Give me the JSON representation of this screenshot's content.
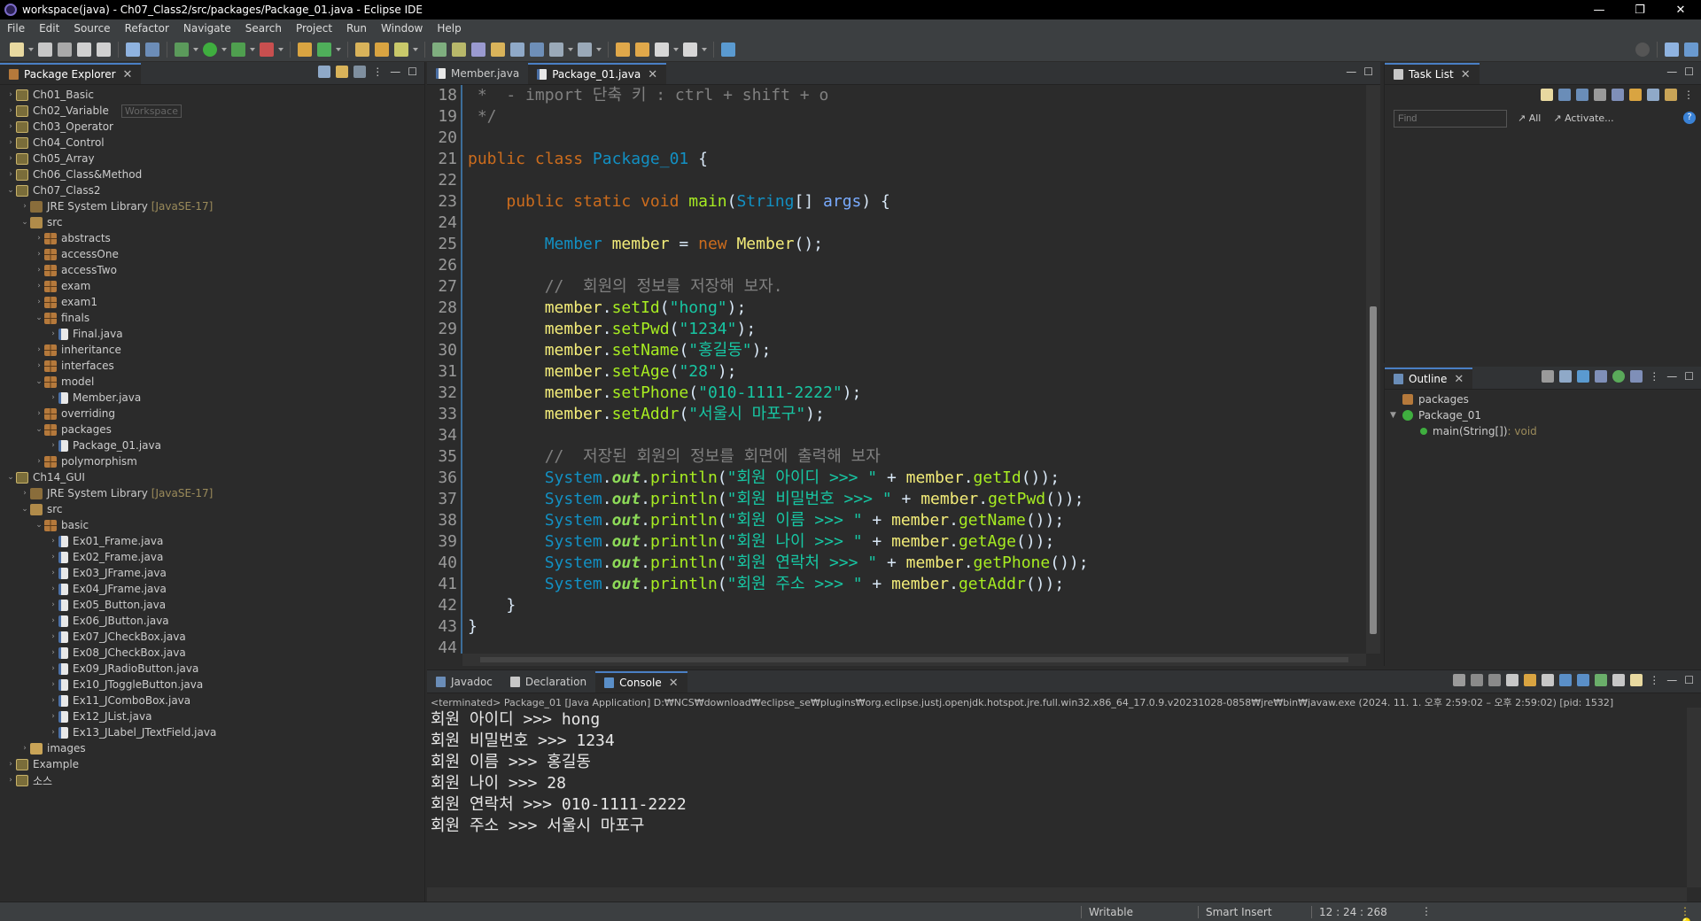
{
  "window": {
    "title": "workspace(java) - Ch07_Class2/src/packages/Package_01.java - Eclipse IDE",
    "minimize": "—",
    "maximize": "❐",
    "close": "✕"
  },
  "menu": [
    "File",
    "Edit",
    "Source",
    "Refactor",
    "Navigate",
    "Search",
    "Project",
    "Run",
    "Window",
    "Help"
  ],
  "explorer": {
    "tab_label": "Package Explorer",
    "workspace_hint": "Workspace",
    "tree": [
      {
        "d": 0,
        "t": "c",
        "icon": "project",
        "label": "Ch01_Basic"
      },
      {
        "d": 0,
        "t": "c",
        "icon": "project",
        "label": "Ch02_Variable",
        "hint": true
      },
      {
        "d": 0,
        "t": "c",
        "icon": "project",
        "label": "Ch03_Operator"
      },
      {
        "d": 0,
        "t": "c",
        "icon": "project",
        "label": "Ch04_Control"
      },
      {
        "d": 0,
        "t": "c",
        "icon": "project",
        "label": "Ch05_Array"
      },
      {
        "d": 0,
        "t": "c",
        "icon": "project",
        "label": "Ch06_Class&Method"
      },
      {
        "d": 0,
        "t": "e",
        "icon": "project",
        "label": "Ch07_Class2"
      },
      {
        "d": 1,
        "t": "c",
        "icon": "lib",
        "label": "JRE System Library",
        "extra": "[JavaSE-17]"
      },
      {
        "d": 1,
        "t": "e",
        "icon": "src",
        "label": "src"
      },
      {
        "d": 2,
        "t": "c",
        "icon": "pkg",
        "label": "abstracts"
      },
      {
        "d": 2,
        "t": "c",
        "icon": "pkg",
        "label": "accessOne"
      },
      {
        "d": 2,
        "t": "c",
        "icon": "pkg",
        "label": "accessTwo"
      },
      {
        "d": 2,
        "t": "c",
        "icon": "pkg",
        "label": "exam"
      },
      {
        "d": 2,
        "t": "c",
        "icon": "pkg",
        "label": "exam1"
      },
      {
        "d": 2,
        "t": "e",
        "icon": "pkg",
        "label": "finals"
      },
      {
        "d": 3,
        "t": "c",
        "icon": "java",
        "label": "Final.java"
      },
      {
        "d": 2,
        "t": "c",
        "icon": "pkg",
        "label": "inheritance"
      },
      {
        "d": 2,
        "t": "c",
        "icon": "pkg",
        "label": "interfaces"
      },
      {
        "d": 2,
        "t": "e",
        "icon": "pkg",
        "label": "model"
      },
      {
        "d": 3,
        "t": "c",
        "icon": "java",
        "label": "Member.java"
      },
      {
        "d": 2,
        "t": "c",
        "icon": "pkg",
        "label": "overriding"
      },
      {
        "d": 2,
        "t": "e",
        "icon": "pkg",
        "label": "packages"
      },
      {
        "d": 3,
        "t": "c",
        "icon": "java",
        "label": "Package_01.java"
      },
      {
        "d": 2,
        "t": "c",
        "icon": "pkg",
        "label": "polymorphism"
      },
      {
        "d": 0,
        "t": "e",
        "icon": "project",
        "label": "Ch14_GUI"
      },
      {
        "d": 1,
        "t": "c",
        "icon": "lib",
        "label": "JRE System Library",
        "extra": "[JavaSE-17]"
      },
      {
        "d": 1,
        "t": "e",
        "icon": "src",
        "label": "src"
      },
      {
        "d": 2,
        "t": "e",
        "icon": "pkg",
        "label": "basic"
      },
      {
        "d": 3,
        "t": "c",
        "icon": "java",
        "label": "Ex01_Frame.java"
      },
      {
        "d": 3,
        "t": "c",
        "icon": "java",
        "label": "Ex02_Frame.java"
      },
      {
        "d": 3,
        "t": "c",
        "icon": "java",
        "label": "Ex03_JFrame.java"
      },
      {
        "d": 3,
        "t": "c",
        "icon": "java",
        "label": "Ex04_JFrame.java"
      },
      {
        "d": 3,
        "t": "c",
        "icon": "java",
        "label": "Ex05_Button.java"
      },
      {
        "d": 3,
        "t": "c",
        "icon": "java",
        "label": "Ex06_JButton.java"
      },
      {
        "d": 3,
        "t": "c",
        "icon": "java",
        "label": "Ex07_JCheckBox.java"
      },
      {
        "d": 3,
        "t": "c",
        "icon": "java",
        "label": "Ex08_JCheckBox.java"
      },
      {
        "d": 3,
        "t": "c",
        "icon": "java",
        "label": "Ex09_JRadioButton.java"
      },
      {
        "d": 3,
        "t": "c",
        "icon": "java",
        "label": "Ex10_JToggleButton.java"
      },
      {
        "d": 3,
        "t": "c",
        "icon": "java",
        "label": "Ex11_JComboBox.java"
      },
      {
        "d": 3,
        "t": "c",
        "icon": "java",
        "label": "Ex12_JList.java"
      },
      {
        "d": 3,
        "t": "c",
        "icon": "java",
        "label": "Ex13_JLabel_JTextField.java"
      },
      {
        "d": 1,
        "t": "c",
        "icon": "folder",
        "label": "images"
      },
      {
        "d": 0,
        "t": "c",
        "icon": "project",
        "label": "Example"
      },
      {
        "d": 0,
        "t": "c",
        "icon": "project",
        "label": "소스"
      }
    ]
  },
  "editor": {
    "tabs": [
      {
        "label": "Member.java",
        "active": false
      },
      {
        "label": "Package_01.java",
        "active": true
      }
    ],
    "lines": [
      {
        "n": "18",
        "s": [
          [
            "cm",
            " *  - import 단축 키 : ctrl + shift + o"
          ]
        ]
      },
      {
        "n": "19",
        "s": [
          [
            "cm",
            " */"
          ]
        ]
      },
      {
        "n": "20",
        "s": []
      },
      {
        "n": "21",
        "s": [
          [
            "kw",
            "public class "
          ],
          [
            "ty",
            "Package_01"
          ],
          [
            "pl",
            " {"
          ]
        ]
      },
      {
        "n": "22",
        "s": []
      },
      {
        "n": "23",
        "s": [
          [
            "pl",
            "    "
          ],
          [
            "kw",
            "public static void "
          ],
          [
            "fn",
            "main"
          ],
          [
            "pl",
            "("
          ],
          [
            "ty",
            "String"
          ],
          [
            "pl",
            "[] "
          ],
          [
            "prm",
            "args"
          ],
          [
            "pl",
            ") {"
          ]
        ],
        "mark": true
      },
      {
        "n": "24",
        "s": []
      },
      {
        "n": "25",
        "s": [
          [
            "pl",
            "        "
          ],
          [
            "ty",
            "Member "
          ],
          [
            "var",
            "member"
          ],
          [
            "pl",
            " = "
          ],
          [
            "kw",
            "new "
          ],
          [
            "var",
            "Member"
          ],
          [
            "pl",
            "();"
          ]
        ]
      },
      {
        "n": "26",
        "s": []
      },
      {
        "n": "27",
        "s": [
          [
            "pl",
            "        "
          ],
          [
            "cm",
            "//  회원의 정보를 저장해 보자."
          ]
        ]
      },
      {
        "n": "28",
        "s": [
          [
            "pl",
            "        "
          ],
          [
            "var",
            "member"
          ],
          [
            "pl",
            "."
          ],
          [
            "fn",
            "setId"
          ],
          [
            "pl",
            "("
          ],
          [
            "st",
            "\"hong\""
          ],
          [
            "pl",
            ");"
          ]
        ]
      },
      {
        "n": "29",
        "s": [
          [
            "pl",
            "        "
          ],
          [
            "var",
            "member"
          ],
          [
            "pl",
            "."
          ],
          [
            "fn",
            "setPwd"
          ],
          [
            "pl",
            "("
          ],
          [
            "st",
            "\"1234\""
          ],
          [
            "pl",
            ");"
          ]
        ]
      },
      {
        "n": "30",
        "s": [
          [
            "pl",
            "        "
          ],
          [
            "var",
            "member"
          ],
          [
            "pl",
            "."
          ],
          [
            "fn",
            "setName"
          ],
          [
            "pl",
            "("
          ],
          [
            "st",
            "\"홍길동\""
          ],
          [
            "pl",
            ");"
          ]
        ]
      },
      {
        "n": "31",
        "s": [
          [
            "pl",
            "        "
          ],
          [
            "var",
            "member"
          ],
          [
            "pl",
            "."
          ],
          [
            "fn",
            "setAge"
          ],
          [
            "pl",
            "("
          ],
          [
            "st",
            "\"28\""
          ],
          [
            "pl",
            ");"
          ]
        ]
      },
      {
        "n": "32",
        "s": [
          [
            "pl",
            "        "
          ],
          [
            "var",
            "member"
          ],
          [
            "pl",
            "."
          ],
          [
            "fn",
            "setPhone"
          ],
          [
            "pl",
            "("
          ],
          [
            "st",
            "\"010-1111-2222\""
          ],
          [
            "pl",
            ");"
          ]
        ]
      },
      {
        "n": "33",
        "s": [
          [
            "pl",
            "        "
          ],
          [
            "var",
            "member"
          ],
          [
            "pl",
            "."
          ],
          [
            "fn",
            "setAddr"
          ],
          [
            "pl",
            "("
          ],
          [
            "st",
            "\"서울시 마포구\""
          ],
          [
            "pl",
            ");"
          ]
        ]
      },
      {
        "n": "34",
        "s": []
      },
      {
        "n": "35",
        "s": [
          [
            "pl",
            "        "
          ],
          [
            "cm",
            "//  저장된 회원의 정보를 회면에 출력해 보자"
          ]
        ]
      },
      {
        "n": "36",
        "s": [
          [
            "pl",
            "        "
          ],
          [
            "ty",
            "System"
          ],
          [
            "pl",
            "."
          ],
          [
            "it",
            "out"
          ],
          [
            "pl",
            "."
          ],
          [
            "fn",
            "println"
          ],
          [
            "pl",
            "("
          ],
          [
            "st",
            "\"회원 아이디 >>> \""
          ],
          [
            "pl",
            " + "
          ],
          [
            "var",
            "member"
          ],
          [
            "pl",
            "."
          ],
          [
            "fn",
            "getId"
          ],
          [
            "pl",
            "());"
          ]
        ]
      },
      {
        "n": "37",
        "s": [
          [
            "pl",
            "        "
          ],
          [
            "ty",
            "System"
          ],
          [
            "pl",
            "."
          ],
          [
            "it",
            "out"
          ],
          [
            "pl",
            "."
          ],
          [
            "fn",
            "println"
          ],
          [
            "pl",
            "("
          ],
          [
            "st",
            "\"회원 비밀번호 >>> \""
          ],
          [
            "pl",
            " + "
          ],
          [
            "var",
            "member"
          ],
          [
            "pl",
            "."
          ],
          [
            "fn",
            "getPwd"
          ],
          [
            "pl",
            "());"
          ]
        ]
      },
      {
        "n": "38",
        "s": [
          [
            "pl",
            "        "
          ],
          [
            "ty",
            "System"
          ],
          [
            "pl",
            "."
          ],
          [
            "it",
            "out"
          ],
          [
            "pl",
            "."
          ],
          [
            "fn",
            "println"
          ],
          [
            "pl",
            "("
          ],
          [
            "st",
            "\"회원 이름 >>> \""
          ],
          [
            "pl",
            " + "
          ],
          [
            "var",
            "member"
          ],
          [
            "pl",
            "."
          ],
          [
            "fn",
            "getName"
          ],
          [
            "pl",
            "());"
          ]
        ]
      },
      {
        "n": "39",
        "s": [
          [
            "pl",
            "        "
          ],
          [
            "ty",
            "System"
          ],
          [
            "pl",
            "."
          ],
          [
            "it",
            "out"
          ],
          [
            "pl",
            "."
          ],
          [
            "fn",
            "println"
          ],
          [
            "pl",
            "("
          ],
          [
            "st",
            "\"회원 나이 >>> \""
          ],
          [
            "pl",
            " + "
          ],
          [
            "var",
            "member"
          ],
          [
            "pl",
            "."
          ],
          [
            "fn",
            "getAge"
          ],
          [
            "pl",
            "());"
          ]
        ]
      },
      {
        "n": "40",
        "s": [
          [
            "pl",
            "        "
          ],
          [
            "ty",
            "System"
          ],
          [
            "pl",
            "."
          ],
          [
            "it",
            "out"
          ],
          [
            "pl",
            "."
          ],
          [
            "fn",
            "println"
          ],
          [
            "pl",
            "("
          ],
          [
            "st",
            "\"회원 연락처 >>> \""
          ],
          [
            "pl",
            " + "
          ],
          [
            "var",
            "member"
          ],
          [
            "pl",
            "."
          ],
          [
            "fn",
            "getPhone"
          ],
          [
            "pl",
            "());"
          ]
        ]
      },
      {
        "n": "41",
        "s": [
          [
            "pl",
            "        "
          ],
          [
            "ty",
            "System"
          ],
          [
            "pl",
            "."
          ],
          [
            "it",
            "out"
          ],
          [
            "pl",
            "."
          ],
          [
            "fn",
            "println"
          ],
          [
            "pl",
            "("
          ],
          [
            "st",
            "\"회원 주소 >>> \""
          ],
          [
            "pl",
            " + "
          ],
          [
            "var",
            "member"
          ],
          [
            "pl",
            "."
          ],
          [
            "fn",
            "getAddr"
          ],
          [
            "pl",
            "());"
          ]
        ]
      },
      {
        "n": "42",
        "s": [
          [
            "pl",
            "    }"
          ]
        ]
      },
      {
        "n": "43",
        "s": [
          [
            "pl",
            "}"
          ]
        ]
      },
      {
        "n": "44",
        "s": []
      }
    ]
  },
  "tasklist": {
    "tab_label": "Task List",
    "find_placeholder": "Find",
    "all_label": "All",
    "activate_label": "Activate...",
    "help": "?"
  },
  "outline": {
    "tab_label": "Outline",
    "items": [
      {
        "label": "packages",
        "d": 0,
        "icon": "pkg"
      },
      {
        "label": "Package_01",
        "d": 0,
        "icon": "class"
      },
      {
        "label": "main(String[])",
        "extra": " : void",
        "d": 1,
        "icon": "method"
      }
    ]
  },
  "console": {
    "tabs": [
      {
        "label": "Javadoc",
        "active": false
      },
      {
        "label": "Declaration",
        "active": false
      },
      {
        "label": "Console",
        "active": true
      }
    ],
    "terminated": "<terminated> Package_01 [Java Application] D:₩NCS₩download₩eclipse_se₩plugins₩org.eclipse.justj.openjdk.hotspot.jre.full.win32.x86_64_17.0.9.v20231028-0858₩jre₩bin₩javaw.exe  (2024. 11. 1. 오후 2:59:02 – 오후 2:59:02) [pid: 1532]",
    "output": [
      "회원 아이디 >>> hong",
      "회원 비밀번호 >>> 1234",
      "회원 이름 >>> 홍길동",
      "회원 나이 >>> 28",
      "회원 연락처 >>> 010-1111-2222",
      "회원 주소 >>> 서울시 마포구"
    ]
  },
  "status": {
    "mode": "Writable",
    "insert": "Smart Insert",
    "position": "12 : 24 : 268"
  }
}
